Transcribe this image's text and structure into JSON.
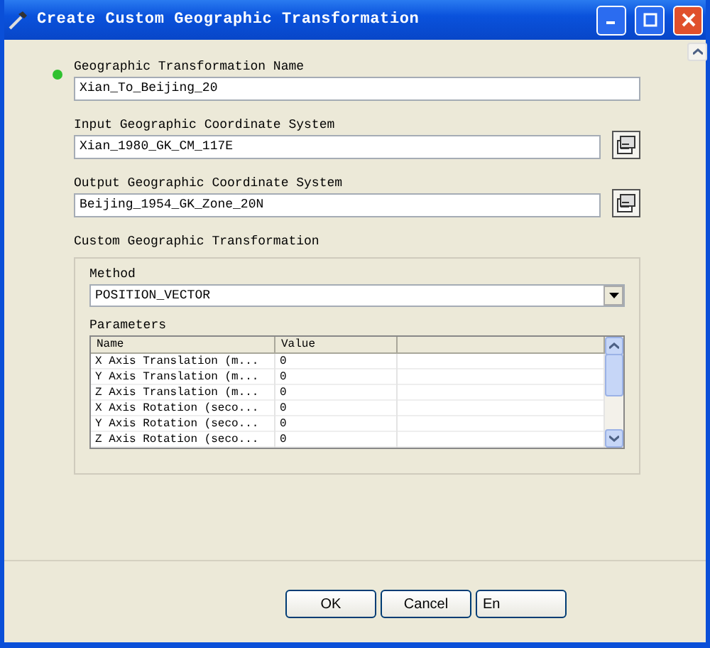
{
  "window": {
    "title": "Create Custom Geographic Transformation"
  },
  "name_field": {
    "label": "Geographic Transformation Name",
    "value": "Xian_To_Beijing_20",
    "required": true
  },
  "input_gcs": {
    "label": "Input Geographic Coordinate System",
    "value": "Xian_1980_GK_CM_117E"
  },
  "output_gcs": {
    "label": "Output Geographic Coordinate System",
    "value": "Beijing_1954_GK_Zone_20N"
  },
  "custom": {
    "title": "Custom Geographic Transformation",
    "method_label": "Method",
    "method": "POSITION_VECTOR",
    "parameters_label": "Parameters",
    "columns": [
      "Name",
      "Value"
    ],
    "rows": [
      {
        "name": "X Axis Translation (m...",
        "value": "0"
      },
      {
        "name": "Y Axis Translation (m...",
        "value": "0"
      },
      {
        "name": "Z Axis Translation (m...",
        "value": "0"
      },
      {
        "name": "X Axis Rotation (seco...",
        "value": "0"
      },
      {
        "name": "Y Axis Rotation (seco...",
        "value": "0"
      },
      {
        "name": "Z Axis Rotation (seco...",
        "value": "0"
      }
    ]
  },
  "buttons": [
    "OK",
    "Cancel",
    "En"
  ]
}
